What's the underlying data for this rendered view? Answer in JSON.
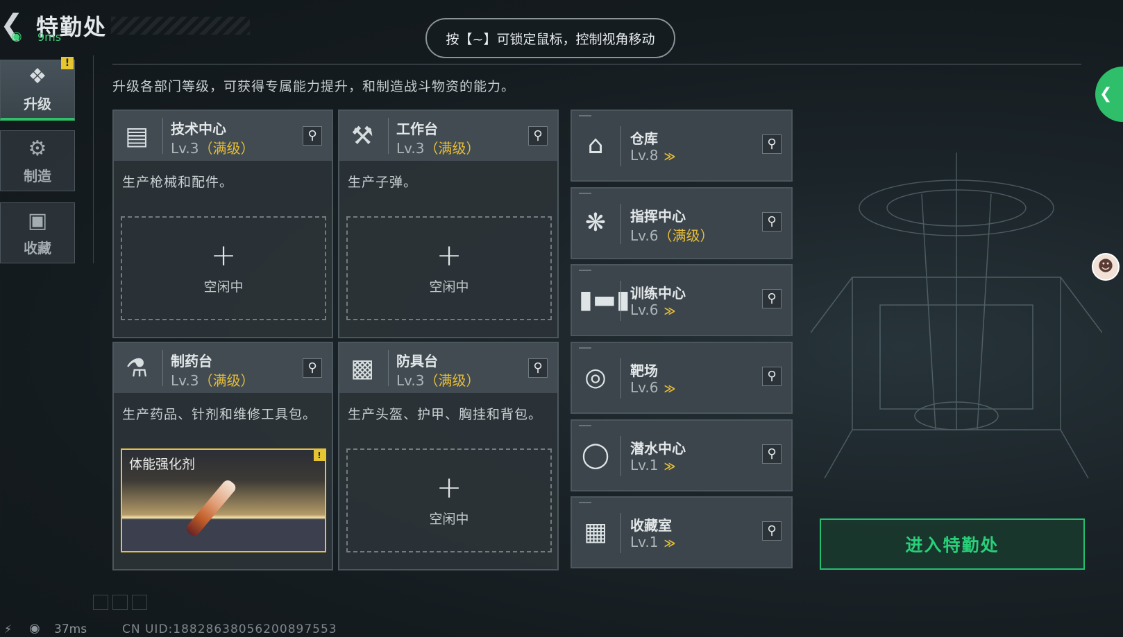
{
  "header": {
    "title": "特勤处",
    "ping": "9ms",
    "hint": "按【~】可锁定鼠标，控制视角移动",
    "description": "升级各部门等级，可获得专属能力提升，和制造战斗物资的能力。"
  },
  "sidebar": {
    "items": [
      {
        "label": "升级",
        "icon": "upgrade-icon",
        "active": true,
        "warning": "!"
      },
      {
        "label": "制造",
        "icon": "gears-icon",
        "active": false
      },
      {
        "label": "收藏",
        "icon": "collection-icon",
        "active": false
      }
    ]
  },
  "cards": [
    {
      "name": "技术中心",
      "level": "Lv.3",
      "max": "（满级）",
      "icon": "computer-icon",
      "desc": "生产枪械和配件。",
      "slot": {
        "state": "idle",
        "plus": "+",
        "label": "空闲中"
      }
    },
    {
      "name": "工作台",
      "level": "Lv.3",
      "max": "（满级）",
      "icon": "tools-icon",
      "desc": "生产子弹。",
      "slot": {
        "state": "idle",
        "plus": "+",
        "label": "空闲中"
      }
    },
    {
      "name": "制药台",
      "level": "Lv.3",
      "max": "（满级）",
      "icon": "microscope-icon",
      "desc": "生产药品、针剂和维修工具包。",
      "slot": {
        "state": "product",
        "label": "体能强化剂",
        "warning": "!"
      }
    },
    {
      "name": "防具台",
      "level": "Lv.3",
      "max": "（满级）",
      "icon": "armor-boxes-icon",
      "desc": "生产头盔、护甲、胸挂和背包。",
      "slot": {
        "state": "idle",
        "plus": "+",
        "label": "空闲中"
      }
    }
  ],
  "departments": [
    {
      "name": "仓库",
      "level": "Lv.8",
      "max": "",
      "icon": "warehouse-icon",
      "upgrade": "≫"
    },
    {
      "name": "指挥中心",
      "level": "Lv.6",
      "max": "（满级）",
      "icon": "command-icon",
      "upgrade": ""
    },
    {
      "name": "训练中心",
      "level": "Lv.6",
      "max": "",
      "icon": "dumbbell-icon",
      "upgrade": "≫"
    },
    {
      "name": "靶场",
      "level": "Lv.6",
      "max": "",
      "icon": "target-icon",
      "upgrade": "≫"
    },
    {
      "name": "潜水中心",
      "level": "Lv.1",
      "max": "",
      "icon": "diving-mask-icon",
      "upgrade": "≫"
    },
    {
      "name": "收藏室",
      "level": "Lv.1",
      "max": "",
      "icon": "collection-room-icon",
      "upgrade": "≫"
    }
  ],
  "enter_button": "进入特勤处",
  "footer": {
    "ping": "37ms",
    "uid": "CN UID:18828638056200897553"
  },
  "colors": {
    "accent_green": "#28d07a",
    "max_gold": "#e6bd3a",
    "warning_yellow": "#e6c532"
  }
}
